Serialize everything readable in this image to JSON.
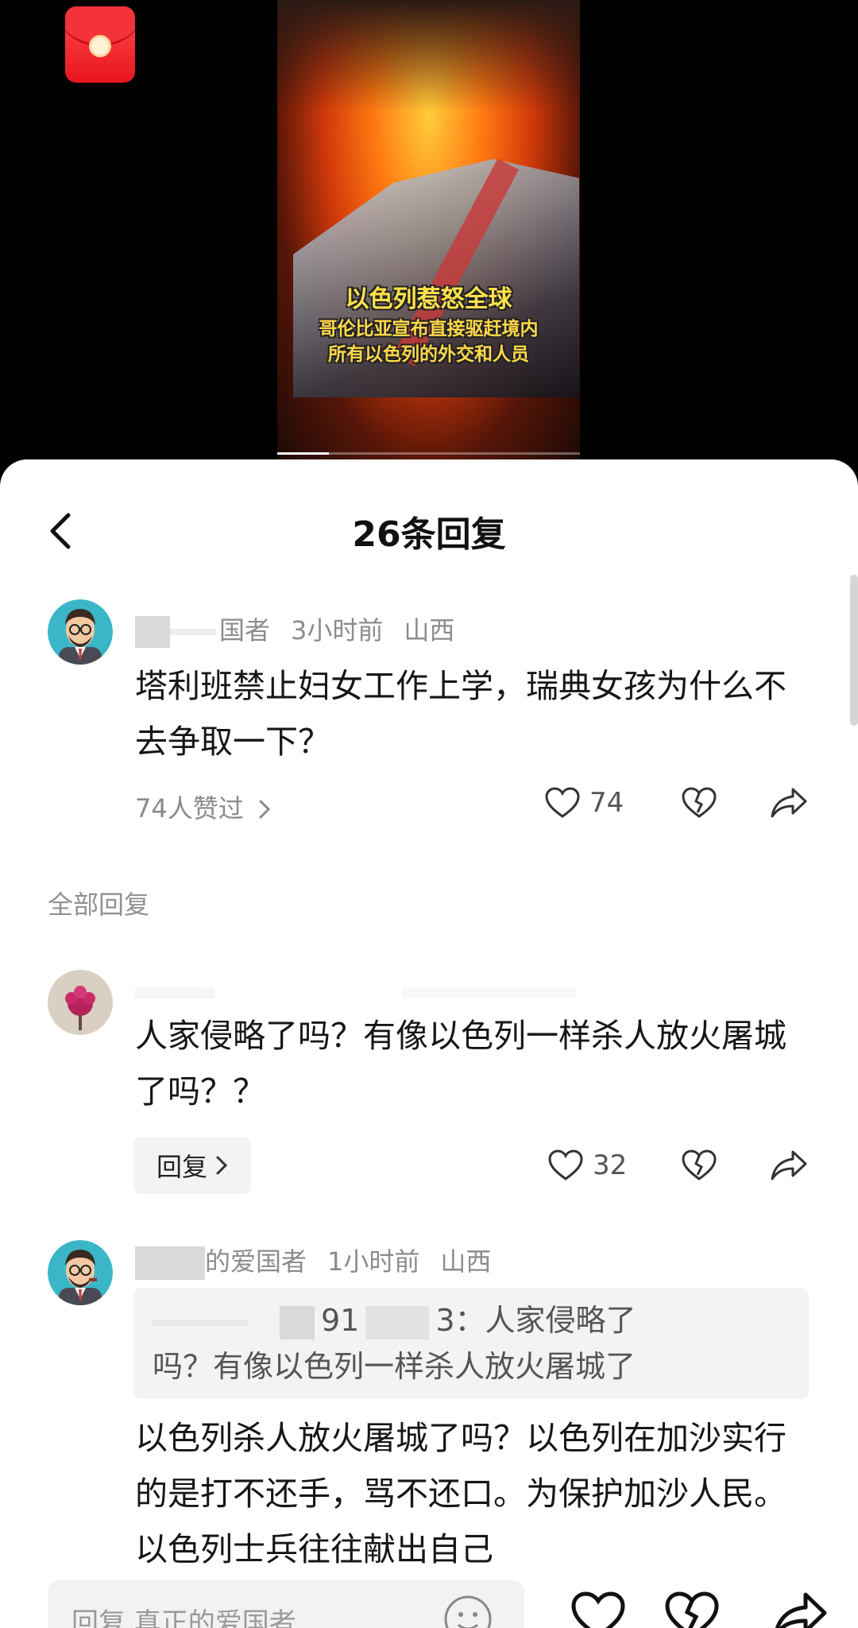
{
  "video": {
    "caption_line1": "以色列惹怒全球",
    "caption_line2": "哥伦比亚宣布直接驱赶境内",
    "caption_line3": "所有以色列的外交和人员",
    "progress": 0.17
  },
  "header": {
    "title": "26条回复"
  },
  "main_comment": {
    "user_suffix": "国者",
    "time": "3小时前",
    "location": "山西",
    "text": "塔利班禁止妇女工作上学，瑞典女孩为什么不去争取一下？",
    "likes_summary": "74人赞过",
    "like_count": "74"
  },
  "section_label": "全部回复",
  "reply1": {
    "text": "人家侵略了吗？有像以色列一样杀人放火屠城了吗？？",
    "reply_button": "回复",
    "like_count": "32"
  },
  "reply2": {
    "user_suffix": "的爱国者",
    "time": "1小时前",
    "location": "山西",
    "quote_prefix": "91",
    "quote_mid": "3：",
    "quote_text1": "人家侵略了",
    "quote_text2": "吗？有像以色列一样杀人放火屠城了",
    "text": "以色列杀人放火屠城了吗？以色列在加沙实行的是打不还手，骂不还口。为保护加沙人民。以色列士兵往往献出自己"
  },
  "bottom_bar": {
    "input_placeholder": "回复 真正的爱国者"
  },
  "colors": {
    "accent_red": "#f0282e",
    "text_primary": "#161616",
    "text_secondary": "#8c8c8c"
  }
}
